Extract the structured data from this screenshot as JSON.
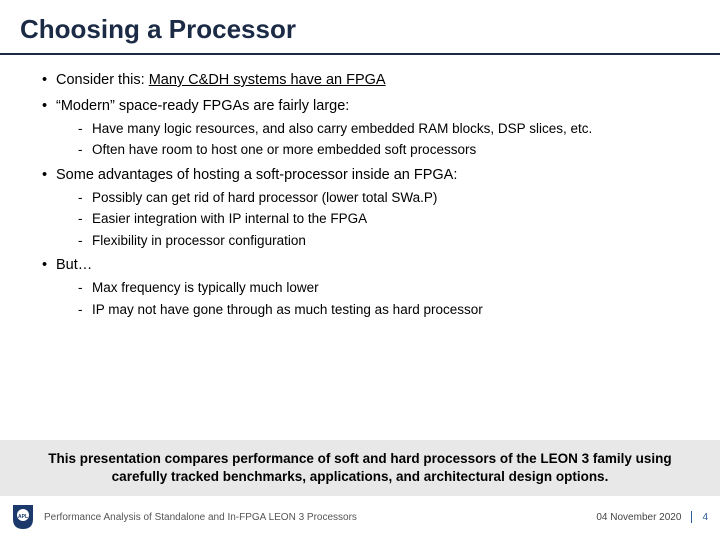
{
  "title": "Choosing a Processor",
  "bullets": {
    "b1_prefix": "Consider this: ",
    "b1_underline": "Many C&DH systems have an FPGA",
    "b2": "“Modern” space-ready FPGAs are fairly large:",
    "b2_sub1": "Have many logic resources, and also carry embedded RAM blocks, DSP slices, etc.",
    "b2_sub2": "Often have room to host one or more embedded soft processors",
    "b3": "Some advantages of hosting a soft-processor inside an FPGA:",
    "b3_sub1": "Possibly can get rid of hard processor (lower total SWa.P)",
    "b3_sub2": "Easier integration with IP internal to the FPGA",
    "b3_sub3": "Flexibility in processor configuration",
    "b4": "But…",
    "b4_sub1": "Max frequency is typically much lower",
    "b4_sub2": "IP may not have gone through as much testing as hard processor"
  },
  "callout": "This presentation compares performance of soft and hard processors of the LEON 3 family using carefully tracked benchmarks, applications, and architectural design options.",
  "footer": {
    "title": "Performance Analysis of Standalone and In-FPGA LEON 3 Processors",
    "date": "04 November 2020",
    "page": "4"
  }
}
